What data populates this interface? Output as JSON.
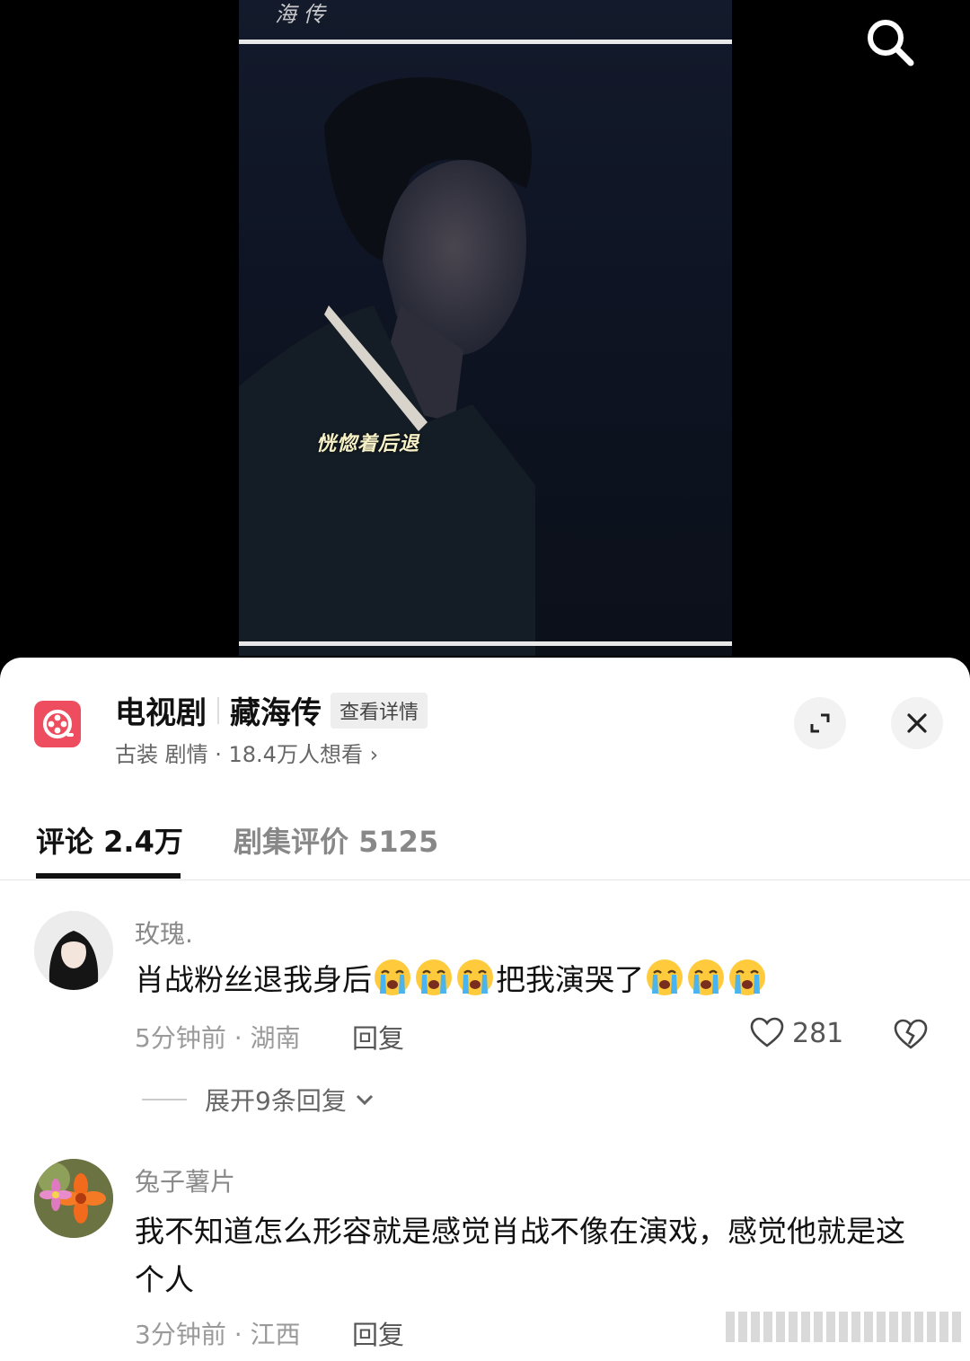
{
  "video": {
    "logo_text": "海 传",
    "subtitle": "恍惚着后退"
  },
  "drama": {
    "category": "电视剧",
    "name": "藏海传",
    "detail_label": "查看详情",
    "meta": "古装 剧情 · 18.4万人想看",
    "meta_chevron": "›"
  },
  "tabs": [
    {
      "label": "评论 2.4万",
      "active": true
    },
    {
      "label": "剧集评价 5125",
      "active": false
    }
  ],
  "comments": [
    {
      "username": "玫瑰.",
      "text_parts": [
        "肖战粉丝退我身后",
        "把我演哭了"
      ],
      "emoji_groups": [
        3,
        3
      ],
      "time": "5分钟前 · 湖南",
      "reply_label": "回复",
      "likes": "281",
      "expand_label": "展开9条回复"
    },
    {
      "username": "兔子薯片",
      "text": "我不知道怎么形容就是感觉肖战不像在演戏，感觉他就是这个人",
      "time": "3分钟前 · 江西",
      "reply_label": "回复"
    }
  ],
  "colors": {
    "drama_icon": "#ee4d5f",
    "username": "#8a8a8a",
    "text": "#111111"
  }
}
